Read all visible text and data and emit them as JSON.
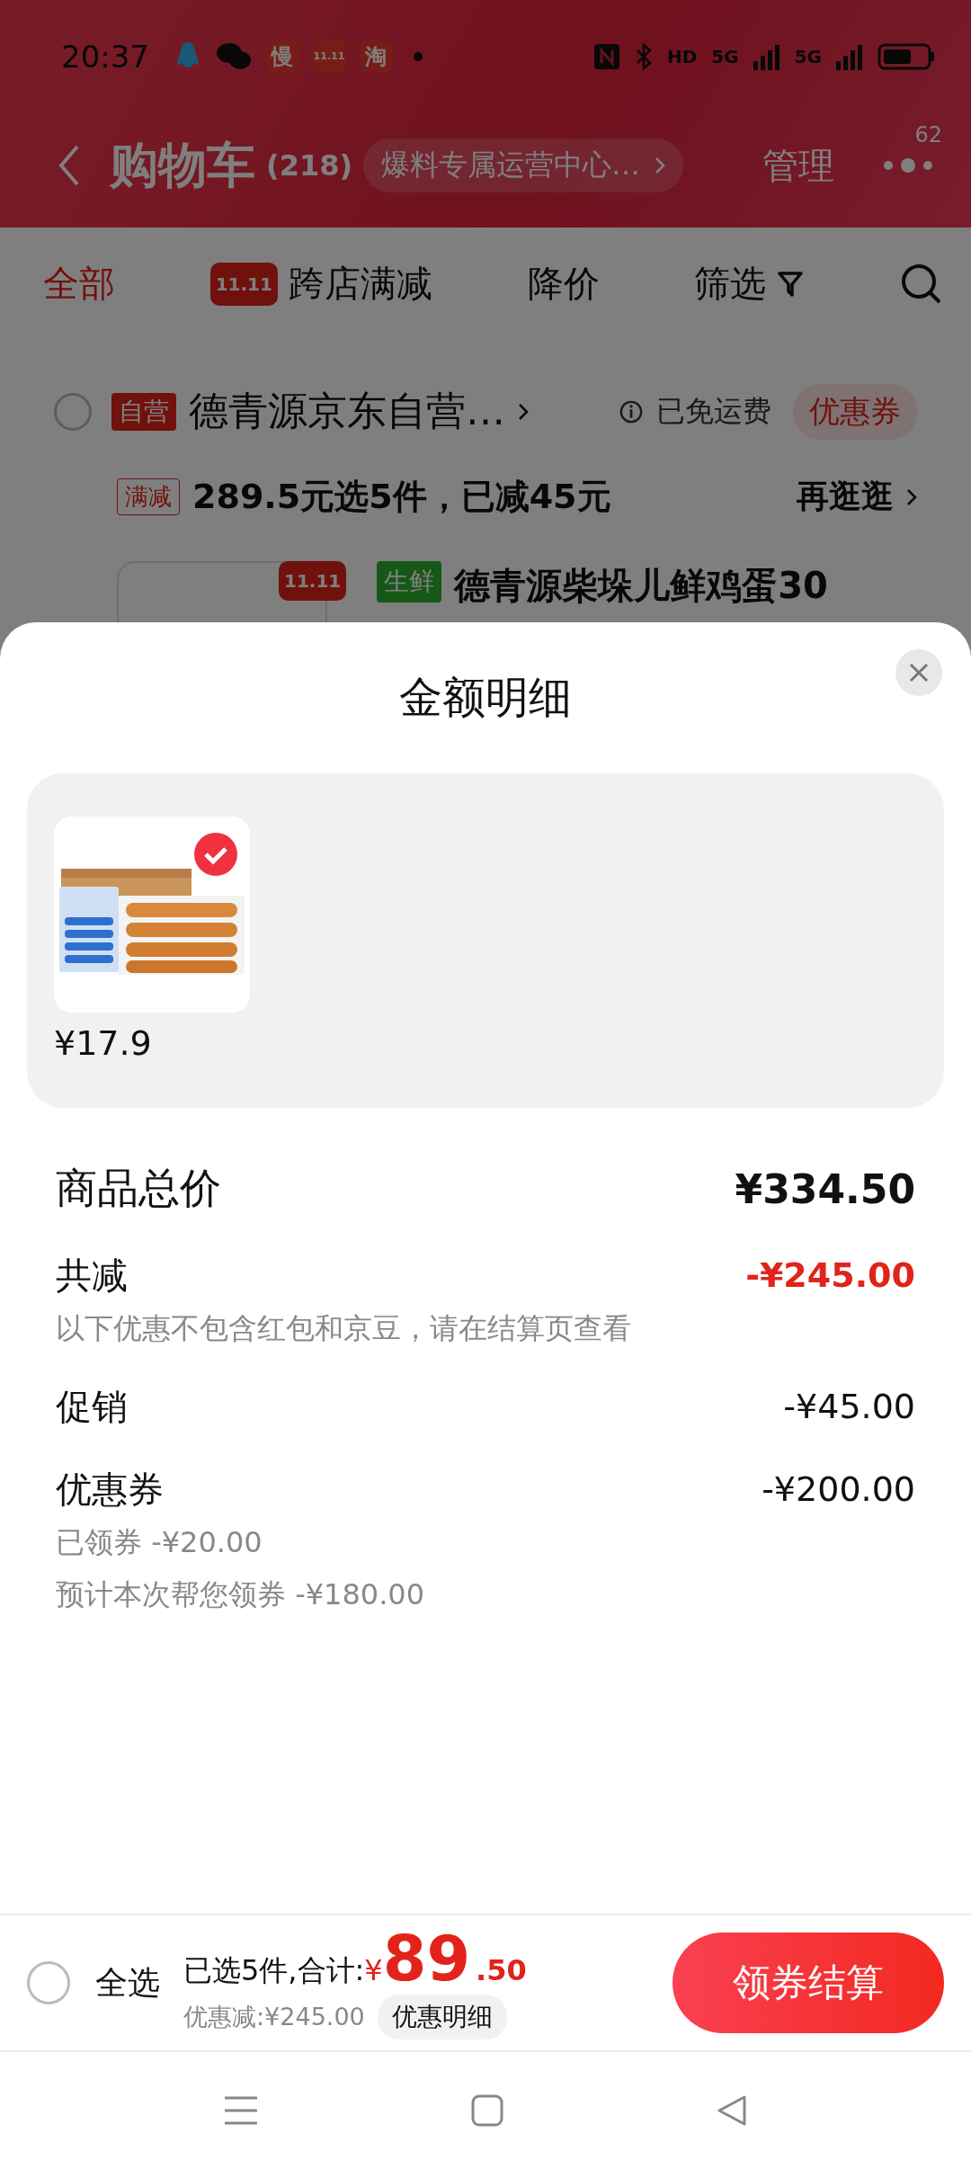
{
  "status_bar": {
    "time": "20:37",
    "app_icons": [
      {
        "kind": "penguin"
      },
      {
        "kind": "chat"
      },
      {
        "kind": "badge",
        "label": "慢"
      },
      {
        "kind": "mascot",
        "label": "11.11"
      },
      {
        "kind": "badge",
        "label": "淘"
      }
    ],
    "network": [
      "HD",
      "5G",
      "5G"
    ]
  },
  "header": {
    "title": "购物车",
    "count": "(218)",
    "channel": "爆料专属运营中心…",
    "manage": "管理",
    "badge": "62"
  },
  "tabs": [
    {
      "label": "全部",
      "selected": true,
      "kind": "plain"
    },
    {
      "label": "跨店满减",
      "selected": false,
      "kind": "promo",
      "logo": "11.11"
    },
    {
      "label": "降价",
      "selected": false,
      "kind": "plain"
    },
    {
      "label": "筛选",
      "selected": false,
      "kind": "filter"
    }
  ],
  "store": {
    "checked": false,
    "tag": "自营",
    "name": "德青源京东自营…",
    "shipping": "已免运费",
    "coupon": "优惠券",
    "promo_tag": "满减",
    "promo": "289.5元选5件，已减45元",
    "more": "再逛逛",
    "item_logo": "11.11",
    "item_tag": "生鲜",
    "item_title": "德青源柴垛儿鲜鸡蛋30"
  },
  "sheet": {
    "title": "金额明细",
    "items": [
      {
        "kind": "picture",
        "price": "¥17.9",
        "checked": true
      }
    ],
    "rows": [
      {
        "kind": "total",
        "label": "商品总价",
        "value": "¥334.50"
      },
      {
        "kind": "discount",
        "label": "共减",
        "value": "-¥245.00",
        "notes": [
          "以下优惠不包含红包和京豆，请在结算页查看"
        ]
      },
      {
        "kind": "line",
        "label": "促销",
        "value": "-¥45.00"
      },
      {
        "kind": "line",
        "label": "优惠券",
        "value": "-¥200.00",
        "notes": [
          "已领券 -¥20.00",
          "预计本次帮您领券 -¥180.00"
        ]
      }
    ]
  },
  "footer": {
    "select_all": {
      "label": "全选",
      "checked": false
    },
    "summary": "已选5件,合计:",
    "currency": "¥",
    "amount": "89",
    "cents": ".50",
    "saving": "优惠减:¥245.00",
    "detail": "优惠明细",
    "checkout": "领券结算"
  }
}
